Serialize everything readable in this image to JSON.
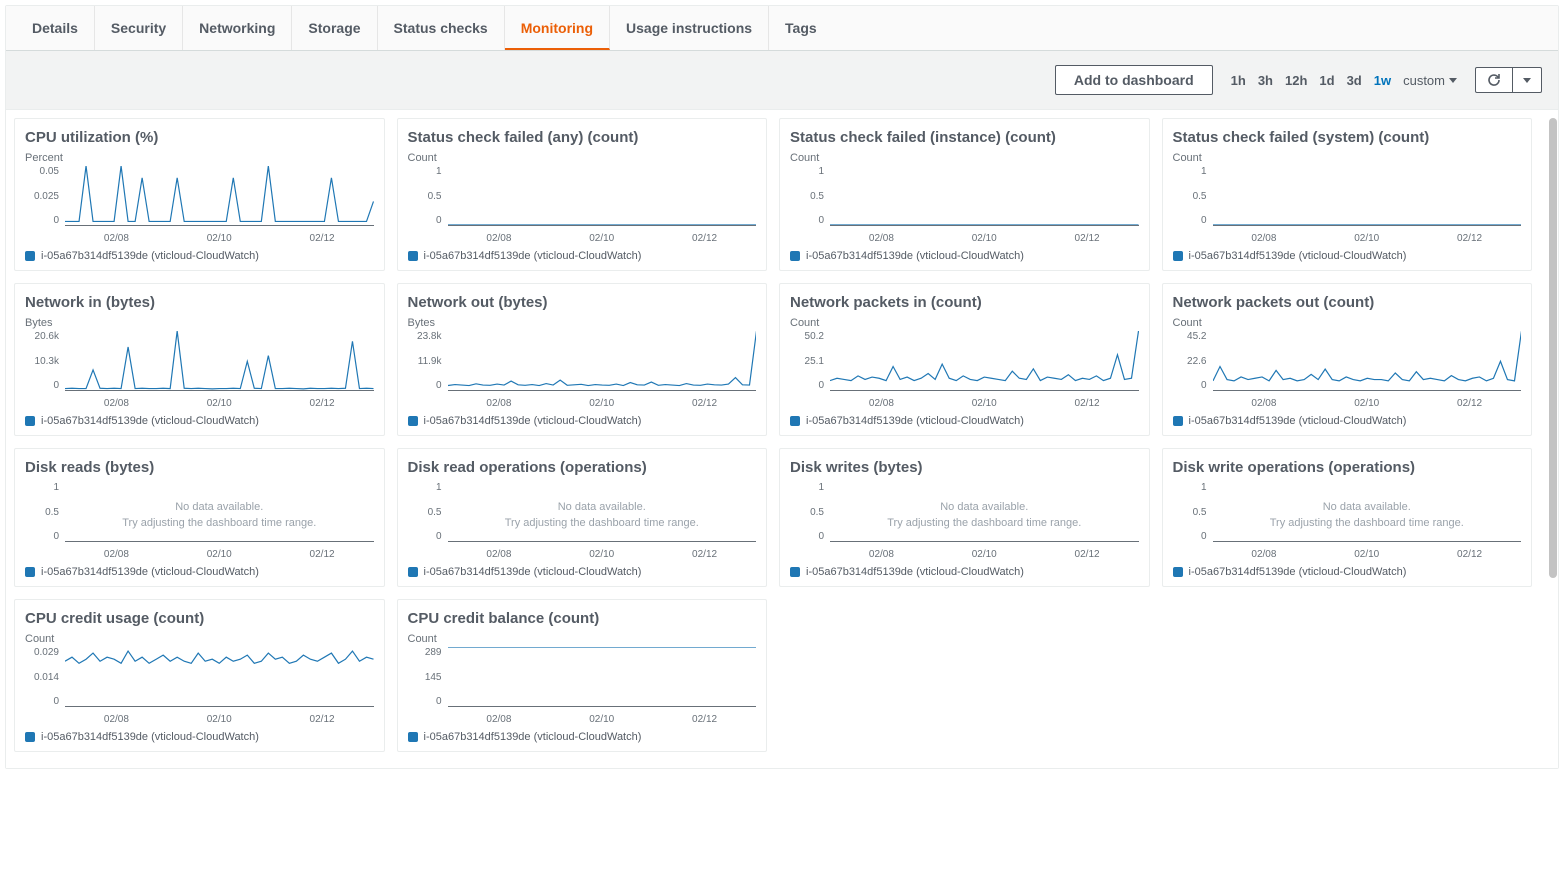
{
  "tabs": [
    "Details",
    "Security",
    "Networking",
    "Storage",
    "Status checks",
    "Monitoring",
    "Usage instructions",
    "Tags"
  ],
  "active_tab": 5,
  "toolbar": {
    "add_to_dashboard": "Add to dashboard",
    "time_ranges": [
      "1h",
      "3h",
      "12h",
      "1d",
      "3d",
      "1w",
      "custom"
    ],
    "active_range_index": 5
  },
  "legend_label": "i-05a67b314df5139de (vticloud-CloudWatch)",
  "no_data_msg1": "No data available.",
  "no_data_msg2": "Try adjusting the dashboard time range.",
  "chart_data": [
    {
      "title": "CPU utilization (%)",
      "unit": "Percent",
      "y_ticks": [
        "0.05",
        "0.025",
        "0"
      ],
      "x_ticks": [
        "02/08",
        "02/10",
        "02/12"
      ],
      "type": "line",
      "ylim": [
        0,
        0.05
      ],
      "values": [
        0.003,
        0.003,
        0.003,
        0.05,
        0.003,
        0.003,
        0.003,
        0.003,
        0.05,
        0.003,
        0.003,
        0.04,
        0.003,
        0.003,
        0.003,
        0.003,
        0.04,
        0.003,
        0.003,
        0.003,
        0.003,
        0.003,
        0.003,
        0.003,
        0.04,
        0.003,
        0.003,
        0.003,
        0.003,
        0.05,
        0.003,
        0.003,
        0.003,
        0.003,
        0.003,
        0.003,
        0.003,
        0.003,
        0.04,
        0.003,
        0.003,
        0.003,
        0.003,
        0.003,
        0.02
      ]
    },
    {
      "title": "Status check failed (any) (count)",
      "unit": "Count",
      "y_ticks": [
        "1",
        "0.5",
        "0"
      ],
      "x_ticks": [
        "02/08",
        "02/10",
        "02/12"
      ],
      "type": "line",
      "ylim": [
        0,
        1
      ],
      "values": [
        0,
        0,
        0,
        0,
        0,
        0,
        0,
        0,
        0,
        0,
        0,
        0,
        0,
        0,
        0,
        0,
        0,
        0,
        0,
        0,
        0,
        0,
        0,
        0,
        0,
        0,
        0,
        0,
        0,
        0,
        0,
        0,
        0,
        0,
        0,
        0,
        0,
        0,
        0,
        0,
        0,
        0,
        0,
        0,
        0
      ]
    },
    {
      "title": "Status check failed (instance) (count)",
      "unit": "Count",
      "y_ticks": [
        "1",
        "0.5",
        "0"
      ],
      "x_ticks": [
        "02/08",
        "02/10",
        "02/12"
      ],
      "type": "line",
      "ylim": [
        0,
        1
      ],
      "values": [
        0,
        0,
        0,
        0,
        0,
        0,
        0,
        0,
        0,
        0,
        0,
        0,
        0,
        0,
        0,
        0,
        0,
        0,
        0,
        0,
        0,
        0,
        0,
        0,
        0,
        0,
        0,
        0,
        0,
        0,
        0,
        0,
        0,
        0,
        0,
        0,
        0,
        0,
        0,
        0,
        0,
        0,
        0,
        0,
        0
      ]
    },
    {
      "title": "Status check failed (system) (count)",
      "unit": "Count",
      "y_ticks": [
        "1",
        "0.5",
        "0"
      ],
      "x_ticks": [
        "02/08",
        "02/10",
        "02/12"
      ],
      "type": "line",
      "ylim": [
        0,
        1
      ],
      "values": [
        0,
        0,
        0,
        0,
        0,
        0,
        0,
        0,
        0,
        0,
        0,
        0,
        0,
        0,
        0,
        0,
        0,
        0,
        0,
        0,
        0,
        0,
        0,
        0,
        0,
        0,
        0,
        0,
        0,
        0,
        0,
        0,
        0,
        0,
        0,
        0,
        0,
        0,
        0,
        0,
        0,
        0,
        0,
        0,
        0
      ]
    },
    {
      "title": "Network in (bytes)",
      "unit": "Bytes",
      "y_ticks": [
        "20.6k",
        "10.3k",
        "0"
      ],
      "x_ticks": [
        "02/08",
        "02/10",
        "02/12"
      ],
      "type": "line",
      "ylim": [
        0,
        20600
      ],
      "values": [
        500,
        600,
        500,
        500,
        7000,
        600,
        500,
        600,
        500,
        15000,
        500,
        600,
        500,
        500,
        600,
        500,
        20600,
        600,
        500,
        600,
        500,
        400,
        500,
        500,
        600,
        500,
        10000,
        600,
        500,
        12000,
        500,
        500,
        600,
        500,
        400,
        600,
        500,
        500,
        600,
        500,
        600,
        17000,
        500,
        600,
        500
      ]
    },
    {
      "title": "Network out (bytes)",
      "unit": "Bytes",
      "y_ticks": [
        "23.8k",
        "11.9k",
        "0"
      ],
      "x_ticks": [
        "02/08",
        "02/10",
        "02/12"
      ],
      "type": "line",
      "ylim": [
        0,
        23800
      ],
      "values": [
        1800,
        2200,
        2000,
        1800,
        2500,
        2000,
        1900,
        2400,
        2000,
        3600,
        2100,
        1900,
        2200,
        1800,
        2600,
        2000,
        4000,
        1900,
        2100,
        2300,
        1800,
        2200,
        2000,
        1900,
        2400,
        1800,
        3000,
        2100,
        2000,
        3200,
        1900,
        2200,
        2000,
        1800,
        2600,
        2000,
        1900,
        2400,
        2100,
        2000,
        2400,
        5000,
        2100,
        2000,
        23800
      ]
    },
    {
      "title": "Network packets in (count)",
      "unit": "Count",
      "y_ticks": [
        "50.2",
        "25.1",
        "0"
      ],
      "x_ticks": [
        "02/08",
        "02/10",
        "02/12"
      ],
      "type": "line",
      "ylim": [
        0,
        50.2
      ],
      "values": [
        8,
        10,
        9,
        8,
        12,
        9,
        11,
        10,
        8,
        20,
        9,
        11,
        8,
        10,
        14,
        9,
        22,
        10,
        8,
        12,
        9,
        8,
        11,
        10,
        9,
        8,
        16,
        10,
        9,
        18,
        8,
        11,
        10,
        9,
        13,
        8,
        10,
        9,
        12,
        8,
        10,
        30,
        9,
        10,
        50.2
      ]
    },
    {
      "title": "Network packets out (count)",
      "unit": "Count",
      "y_ticks": [
        "45.2",
        "22.6",
        "0"
      ],
      "x_ticks": [
        "02/08",
        "02/10",
        "02/12"
      ],
      "type": "line",
      "ylim": [
        0,
        45.2
      ],
      "values": [
        7,
        18,
        8,
        7,
        10,
        8,
        9,
        10,
        7,
        15,
        8,
        9,
        7,
        8,
        12,
        8,
        16,
        8,
        7,
        10,
        8,
        7,
        9,
        8,
        8,
        7,
        13,
        8,
        7,
        14,
        8,
        9,
        8,
        7,
        11,
        8,
        7,
        9,
        10,
        7,
        9,
        22,
        8,
        7,
        45.2
      ]
    },
    {
      "title": "Disk reads (bytes)",
      "unit": null,
      "y_ticks": [
        "1",
        "0.5",
        "0"
      ],
      "x_ticks": [
        "02/08",
        "02/10",
        "02/12"
      ],
      "type": "line",
      "ylim": [
        0,
        1
      ],
      "values": null
    },
    {
      "title": "Disk read operations (operations)",
      "unit": null,
      "y_ticks": [
        "1",
        "0.5",
        "0"
      ],
      "x_ticks": [
        "02/08",
        "02/10",
        "02/12"
      ],
      "type": "line",
      "ylim": [
        0,
        1
      ],
      "values": null
    },
    {
      "title": "Disk writes (bytes)",
      "unit": null,
      "y_ticks": [
        "1",
        "0.5",
        "0"
      ],
      "x_ticks": [
        "02/08",
        "02/10",
        "02/12"
      ],
      "type": "line",
      "ylim": [
        0,
        1
      ],
      "values": null
    },
    {
      "title": "Disk write operations (operations)",
      "unit": null,
      "y_ticks": [
        "1",
        "0.5",
        "0"
      ],
      "x_ticks": [
        "02/08",
        "02/10",
        "02/12"
      ],
      "type": "line",
      "ylim": [
        0,
        1
      ],
      "values": null
    },
    {
      "title": "CPU credit usage (count)",
      "unit": "Count",
      "y_ticks": [
        "0.029",
        "0.014",
        "0"
      ],
      "x_ticks": [
        "02/08",
        "02/10",
        "02/12"
      ],
      "type": "line",
      "ylim": [
        0,
        0.029
      ],
      "values": [
        0.022,
        0.024,
        0.021,
        0.023,
        0.026,
        0.022,
        0.024,
        0.023,
        0.021,
        0.027,
        0.022,
        0.024,
        0.021,
        0.023,
        0.025,
        0.022,
        0.024,
        0.022,
        0.021,
        0.026,
        0.022,
        0.023,
        0.021,
        0.024,
        0.022,
        0.023,
        0.025,
        0.021,
        0.022,
        0.026,
        0.023,
        0.024,
        0.021,
        0.022,
        0.025,
        0.023,
        0.022,
        0.024,
        0.026,
        0.021,
        0.023,
        0.027,
        0.022,
        0.024,
        0.023
      ]
    },
    {
      "title": "CPU credit balance (count)",
      "unit": "Count",
      "y_ticks": [
        "289",
        "145",
        "0"
      ],
      "x_ticks": [
        "02/08",
        "02/10",
        "02/12"
      ],
      "type": "line",
      "ylim": [
        0,
        289
      ],
      "values": [
        289,
        289,
        289,
        289,
        289,
        289,
        289,
        289,
        289,
        289,
        289,
        289,
        289,
        289,
        289,
        289,
        289,
        289,
        289,
        289,
        289,
        289,
        289,
        289,
        289,
        289,
        289,
        289,
        289,
        289,
        289,
        289,
        289,
        289,
        289,
        289,
        289,
        289,
        289,
        289,
        289,
        289,
        289,
        289,
        289
      ]
    }
  ]
}
